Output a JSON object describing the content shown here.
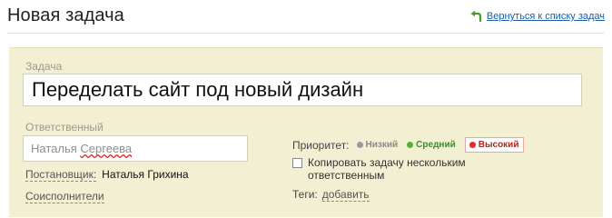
{
  "header": {
    "title": "Новая задача",
    "back_link": "Вернуться к списку задач"
  },
  "form": {
    "task_label": "Задача",
    "task_value": "Переделать сайт под новый дизайн",
    "responsible_label": "Ответственный",
    "responsible_value_first": "Наталья ",
    "responsible_value_last": "Сергеева",
    "setter_label": "Постановщик:",
    "setter_name": "Наталья Грихина",
    "coexecutors_label": "Соисполнители",
    "priority": {
      "label": "Приоритет:",
      "options": [
        "Низкий",
        "Средний",
        "Высокий"
      ],
      "selected": "Высокий"
    },
    "multi_checkbox_label": "Копировать задачу нескольким ответственным",
    "multi_checked": false,
    "tags_label": "Теги:",
    "tags_add": "добавить"
  },
  "colors": {
    "panel_bg": "#f3efd3",
    "link": "#1a5fa8",
    "priority_low": "#9a9a9a",
    "priority_mid": "#58b030",
    "priority_high": "#e02a22"
  }
}
